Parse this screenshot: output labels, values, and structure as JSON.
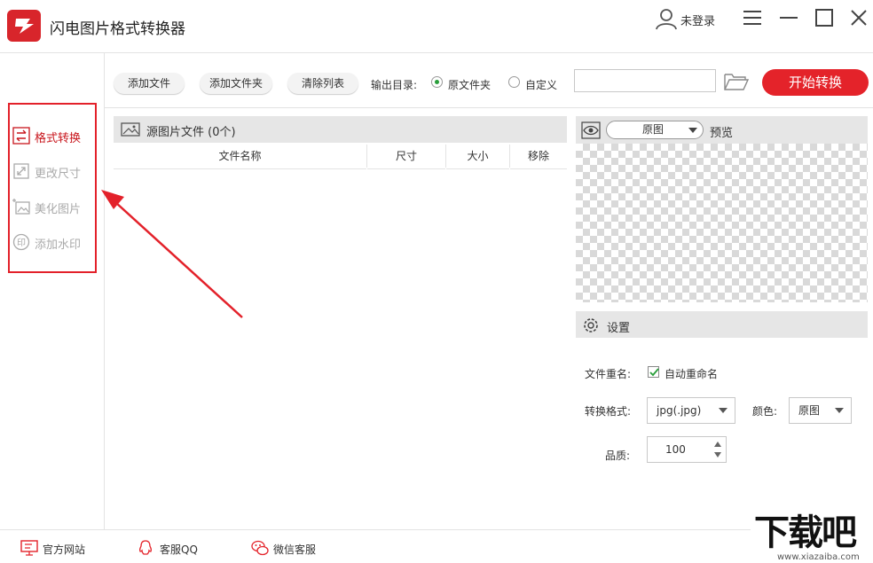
{
  "app": {
    "title": "闪电图片格式转换器",
    "user_label": "未登录",
    "brand_color": "#e4232a"
  },
  "sidebar": {
    "items": [
      {
        "label": "格式转换",
        "icon": "convert-icon",
        "active": true
      },
      {
        "label": "更改尺寸",
        "icon": "resize-icon",
        "active": false
      },
      {
        "label": "美化图片",
        "icon": "beautify-icon",
        "active": false
      },
      {
        "label": "添加水印",
        "icon": "watermark-icon",
        "active": false
      }
    ]
  },
  "toolbar": {
    "add_file": "添加文件",
    "add_folder": "添加文件夹",
    "clear_list": "清除列表",
    "output_label": "输出目录:",
    "radio_original": "原文件夹",
    "radio_custom": "自定义",
    "path_value": "",
    "start_button": "开始转换"
  },
  "file_list": {
    "title": "源图片文件 (0个)",
    "columns": [
      "文件名称",
      "尺寸",
      "大小",
      "移除"
    ],
    "rows": []
  },
  "preview": {
    "mode_value": "原图",
    "label": "预览"
  },
  "settings": {
    "title": "设置",
    "rename_label": "文件重名:",
    "auto_rename_label": "自动重命名",
    "auto_rename_checked": true,
    "format_label": "转换格式:",
    "format_value": "jpg(.jpg)",
    "color_label": "颜色:",
    "color_value": "原图",
    "quality_label": "品质:",
    "quality_value": "100"
  },
  "footer": {
    "website": "官方网站",
    "qq": "客服QQ",
    "wechat": "微信客服"
  },
  "watermark": {
    "big": "下载吧",
    "small": "www.xiazaiba.com"
  }
}
